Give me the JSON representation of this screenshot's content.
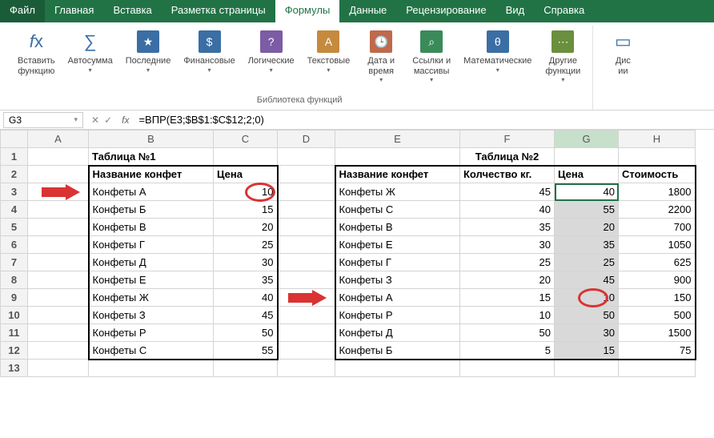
{
  "tabs": {
    "file": "Файл",
    "home": "Главная",
    "insert": "Вставка",
    "layout": "Разметка страницы",
    "formulas": "Формулы",
    "data": "Данные",
    "review": "Рецензирование",
    "view": "Вид",
    "help": "Справка"
  },
  "ribbon": {
    "insert_fn": "Вставить\nфункцию",
    "autosum": "Автосумма",
    "recent": "Последние",
    "financial": "Финансовые",
    "logical": "Логические",
    "text": "Текстовые",
    "datetime": "Дата и\nвремя",
    "lookup": "Ссылки и\nмассивы",
    "math": "Математические",
    "other": "Другие\nфункции",
    "disp": "Дис\nии",
    "group_title": "Библиотека функций",
    "dd": "▾"
  },
  "namebox": "G3",
  "fx_label": "fx",
  "formula": "=ВПР(E3;$B$1:$C$12;2;0)",
  "cols": [
    "A",
    "B",
    "C",
    "D",
    "E",
    "F",
    "G",
    "H"
  ],
  "rows": [
    "1",
    "2",
    "3",
    "4",
    "5",
    "6",
    "7",
    "8",
    "9",
    "10",
    "11",
    "12",
    "13"
  ],
  "t1_title": "Таблица №1",
  "t2_title": "Таблица №2",
  "hdr_name": "Название конфет",
  "hdr_price": "Цена",
  "hdr_qty": "Колчество кг.",
  "hdr_cost": "Стоимость",
  "t1": [
    {
      "n": "Конфеты А",
      "p": 10
    },
    {
      "n": "Конфеты Б",
      "p": 15
    },
    {
      "n": "Конфеты В",
      "p": 20
    },
    {
      "n": "Конфеты Г",
      "p": 25
    },
    {
      "n": "Конфеты Д",
      "p": 30
    },
    {
      "n": "Конфеты Е",
      "p": 35
    },
    {
      "n": "Конфеты Ж",
      "p": 40
    },
    {
      "n": "Конфеты З",
      "p": 45
    },
    {
      "n": "Конфеты Р",
      "p": 50
    },
    {
      "n": "Конфеты С",
      "p": 55
    }
  ],
  "t2": [
    {
      "n": "Конфеты Ж",
      "q": 45,
      "p": 40,
      "c": 1800
    },
    {
      "n": "Конфеты С",
      "q": 40,
      "p": 55,
      "c": 2200
    },
    {
      "n": "Конфеты В",
      "q": 35,
      "p": 20,
      "c": 700
    },
    {
      "n": "Конфеты Е",
      "q": 30,
      "p": 35,
      "c": 1050
    },
    {
      "n": "Конфеты Г",
      "q": 25,
      "p": 25,
      "c": 625
    },
    {
      "n": "Конфеты З",
      "q": 20,
      "p": 45,
      "c": 900
    },
    {
      "n": "Конфеты А",
      "q": 15,
      "p": 10,
      "c": 150
    },
    {
      "n": "Конфеты Р",
      "q": 10,
      "p": 50,
      "c": 500
    },
    {
      "n": "Конфеты Д",
      "q": 50,
      "p": 30,
      "c": 1500
    },
    {
      "n": "Конфеты Б",
      "q": 5,
      "p": 15,
      "c": 75
    }
  ],
  "fx_cancel": "✕",
  "fx_ok": "✓"
}
